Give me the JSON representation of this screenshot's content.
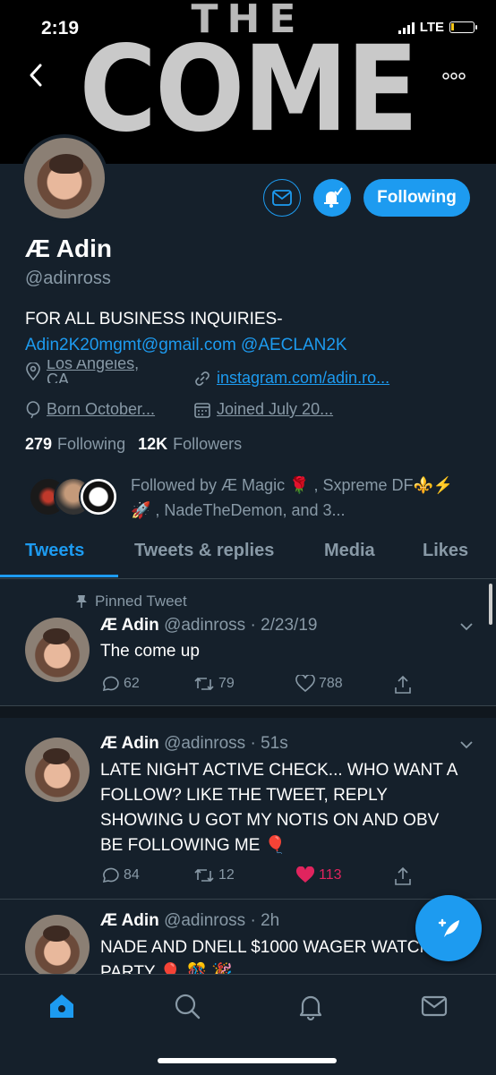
{
  "status": {
    "time": "2:19",
    "network": "LTE"
  },
  "banner": {
    "line1": "THE",
    "line2": "COME UP"
  },
  "profile": {
    "name": "Æ Adin",
    "handle": "@adinross",
    "bio_line1": "FOR ALL BUSINESS INQUIRIES-",
    "bio_line2": "Adin2K20mgmt@gmail.com @AECLAN2K",
    "location": "Los Angeles, CA",
    "website": "instagram.com/adin.ro...",
    "born": "Born October...",
    "joined": "Joined July 20...",
    "following_count": "279",
    "following_label": "Following",
    "followers_count": "12K",
    "followers_label": "Followers",
    "followed_by": "Followed by Æ Magic 🌹 , Sxpreme DF⚜️⚡🚀 , NadeTheDemon, and 3...",
    "follow_button": "Following"
  },
  "tabs": [
    "Tweets",
    "Tweets & replies",
    "Media",
    "Likes"
  ],
  "pinned_label": "Pinned Tweet",
  "tweets": [
    {
      "name": "Æ Adin",
      "meta": "@adinross · 2/23/19",
      "text": "The come up",
      "replies": "62",
      "retweets": "79",
      "likes": "788"
    },
    {
      "name": "Æ Adin",
      "meta": "@adinross · 51s",
      "text": "LATE NIGHT ACTIVE CHECK... WHO WANT A FOLLOW? LIKE THE TWEET, REPLY SHOWING U GOT MY NOTIS ON AND OBV BE FOLLOWING ME 🎈",
      "replies": "84",
      "retweets": "12",
      "likes": "113"
    },
    {
      "name": "Æ Adin",
      "meta": "@adinross · 2h",
      "text": "NADE AND DNELL $1000 WAGER WATCH PARTY 🎈 🎊 🎉",
      "replies": "",
      "retweets": "",
      "likes": ""
    }
  ],
  "colors": {
    "accent": "#1d9bf0",
    "background": "#15202b",
    "liked": "#e0245e",
    "muted": "#8899a6"
  }
}
